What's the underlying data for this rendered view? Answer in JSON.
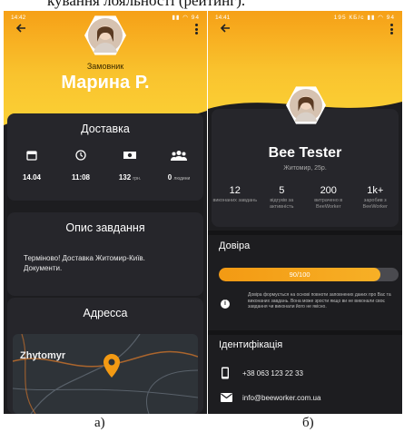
{
  "top_caption": "кування лояльності (рейтинг).",
  "figure_a": {
    "status": {
      "time": "14:42",
      "speed": "0,4 КБ/с",
      "battery": "94"
    },
    "role": "Замовник",
    "name": "Марина Р.",
    "delivery": {
      "title": "Доставка",
      "items": [
        {
          "icon": "calendar-icon",
          "value": "14.04",
          "unit": ""
        },
        {
          "icon": "clock-icon",
          "value": "11:08",
          "unit": ""
        },
        {
          "icon": "money-icon",
          "value": "132",
          "unit": "грн."
        },
        {
          "icon": "people-icon",
          "value": "0",
          "unit": "людини"
        }
      ]
    },
    "task": {
      "title": "Опис завдання",
      "text": "Терміново! Доставка Житомир-Київ. Документи."
    },
    "address": {
      "title": "Адресса",
      "map_label": "Zhytomyr"
    },
    "caption": "а)"
  },
  "figure_b": {
    "status": {
      "time": "14:41",
      "speed": "195 КБ/с",
      "battery": "94"
    },
    "name": "Bee Tester",
    "city": "Житомир, 25р.",
    "stats": [
      {
        "value": "12",
        "label": "виконаних завдань"
      },
      {
        "value": "5",
        "label": "відгуків за активність"
      },
      {
        "value": "200",
        "label": "витрачено в BeeWorker"
      },
      {
        "value": "1k+",
        "label": "заробив з BeeWorker"
      }
    ],
    "trust": {
      "title": "Довіра",
      "progress": 0.9,
      "label": "90/100",
      "info": "Довіра формується на основі повноти заповнених даних про Вас та виконаних завдань. Вона може зрости якщо ви не виконали своє завдання чи виконали його не якісно."
    },
    "identification": {
      "title": "Ідентифікація",
      "phone": "+38 063 123 22 33",
      "email": "info@beeworker.com.ua"
    },
    "caption": "б)"
  },
  "colors": {
    "accent": "#f6a017",
    "dark": "#1d1d20",
    "card": "#26262b"
  }
}
